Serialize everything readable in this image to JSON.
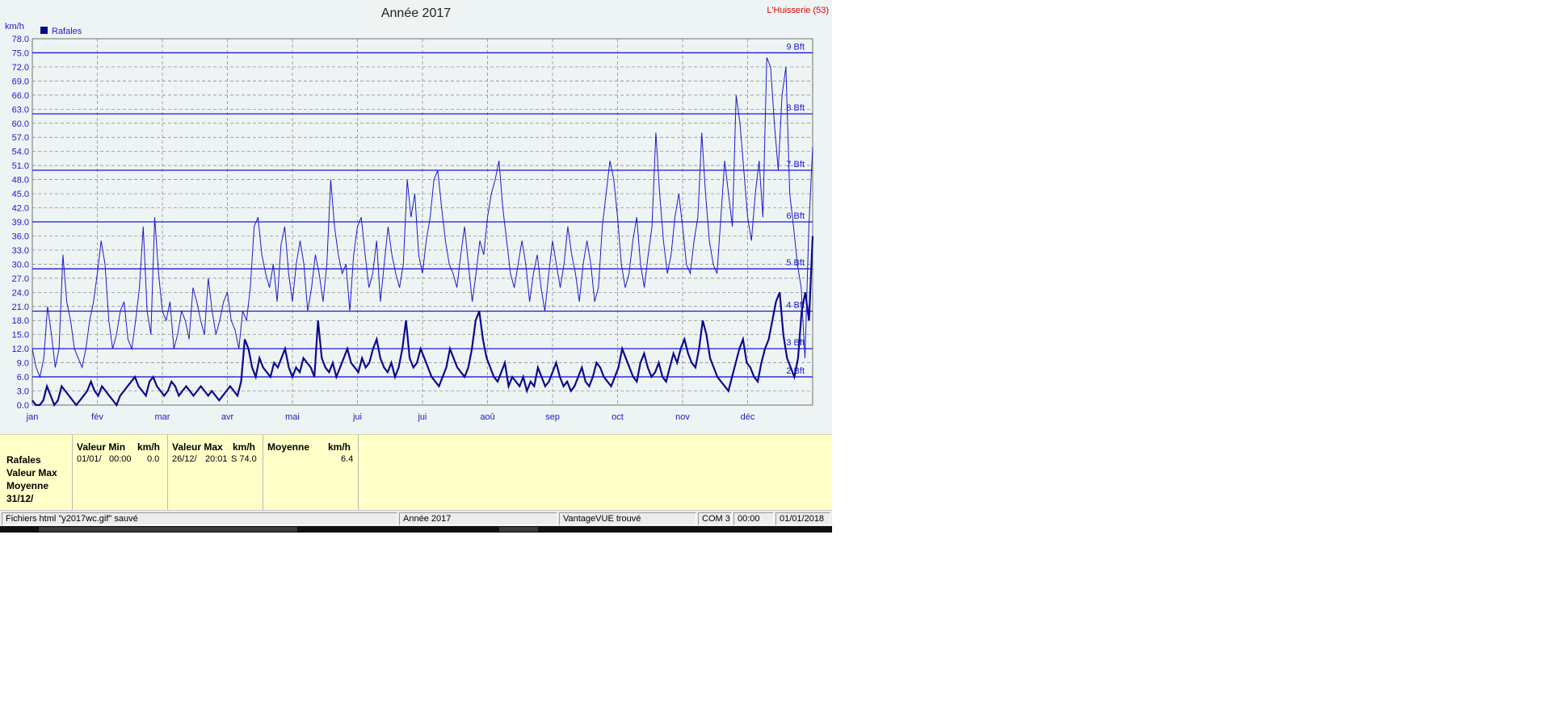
{
  "window": {
    "title": "Année 2017",
    "station": "L'Huisserie (53)"
  },
  "chart_data": {
    "type": "line",
    "title": "Année 2017",
    "ylabel": "km/h",
    "xlabel": "",
    "ylim": [
      0,
      78
    ],
    "yticks": [
      "0.0",
      "3.0",
      "6.0",
      "9.0",
      "12.0",
      "15.0",
      "18.0",
      "21.0",
      "24.0",
      "27.0",
      "30.0",
      "33.0",
      "36.0",
      "39.0",
      "42.0",
      "45.0",
      "48.0",
      "51.0",
      "54.0",
      "57.0",
      "60.0",
      "63.0",
      "66.0",
      "69.0",
      "72.0",
      "75.0",
      "78.0"
    ],
    "categories": [
      "jan",
      "fév",
      "mar",
      "avr",
      "mai",
      "juin",
      "juil",
      "aoû",
      "sep",
      "oct",
      "nov",
      "déc"
    ],
    "xticks": [
      "jan",
      "fév",
      "mar",
      "avr",
      "mai",
      "jui",
      "jui",
      "aoû",
      "sep",
      "oct",
      "nov",
      "déc"
    ],
    "legend": [
      "Rafales"
    ],
    "legend_position": "top-left",
    "grid": true,
    "beaufort": [
      {
        "label": "2 Bft",
        "value": 6
      },
      {
        "label": "3 Bft",
        "value": 12
      },
      {
        "label": "4 Bft",
        "value": 20
      },
      {
        "label": "5 Bft",
        "value": 29
      },
      {
        "label": "6 Bft",
        "value": 39
      },
      {
        "label": "7 Bft",
        "value": 50
      },
      {
        "label": "8 Bft",
        "value": 62
      },
      {
        "label": "9 Bft",
        "value": 75
      }
    ],
    "series": [
      {
        "name": "Rafales",
        "kind": "gusts",
        "color": "#1a1ad0",
        "values": [
          12,
          8,
          6,
          10,
          21,
          15,
          8,
          12,
          32,
          22,
          18,
          12,
          10,
          8,
          12,
          18,
          22,
          28,
          35,
          30,
          18,
          12,
          15,
          20,
          22,
          14,
          12,
          18,
          25,
          38,
          20,
          15,
          40,
          28,
          20,
          18,
          22,
          12,
          15,
          20,
          18,
          14,
          25,
          22,
          18,
          15,
          27,
          20,
          15,
          18,
          22,
          24,
          18,
          16,
          12,
          20,
          18,
          25,
          38,
          40,
          32,
          28,
          25,
          30,
          22,
          34,
          38,
          28,
          22,
          30,
          35,
          30,
          20,
          25,
          32,
          28,
          22,
          30,
          48,
          38,
          32,
          28,
          30,
          20,
          32,
          38,
          40,
          32,
          25,
          28,
          35,
          22,
          30,
          38,
          32,
          28,
          25,
          30,
          48,
          40,
          45,
          32,
          28,
          35,
          40,
          48,
          50,
          42,
          35,
          30,
          28,
          25,
          32,
          38,
          30,
          22,
          28,
          35,
          32,
          40,
          45,
          48,
          52,
          42,
          35,
          28,
          25,
          30,
          35,
          30,
          22,
          28,
          32,
          25,
          20,
          28,
          35,
          30,
          25,
          30,
          38,
          32,
          28,
          22,
          30,
          35,
          30,
          22,
          25,
          38,
          45,
          52,
          48,
          40,
          30,
          25,
          28,
          35,
          40,
          30,
          25,
          32,
          38,
          58,
          45,
          35,
          28,
          32,
          40,
          45,
          38,
          30,
          28,
          35,
          40,
          58,
          45,
          35,
          30,
          28,
          40,
          52,
          45,
          38,
          66,
          60,
          50,
          40,
          35,
          45,
          52,
          40,
          74,
          72,
          60,
          50,
          66,
          72,
          45,
          38,
          30,
          25,
          10,
          38,
          55
        ]
      },
      {
        "name": "Moyenne",
        "kind": "average",
        "color": "#0a0a90",
        "values": [
          1,
          0,
          0,
          1,
          4,
          2,
          0,
          1,
          4,
          3,
          2,
          1,
          0,
          1,
          2,
          3,
          5,
          3,
          2,
          4,
          3,
          2,
          1,
          0,
          2,
          3,
          4,
          5,
          6,
          4,
          3,
          2,
          5,
          6,
          4,
          3,
          2,
          3,
          5,
          4,
          2,
          3,
          4,
          3,
          2,
          3,
          4,
          3,
          2,
          3,
          2,
          1,
          2,
          3,
          4,
          3,
          2,
          5,
          14,
          12,
          8,
          6,
          10,
          8,
          7,
          6,
          9,
          8,
          10,
          12,
          8,
          6,
          8,
          7,
          10,
          9,
          8,
          6,
          18,
          10,
          8,
          7,
          9,
          6,
          8,
          10,
          12,
          9,
          8,
          7,
          10,
          8,
          9,
          12,
          14,
          10,
          8,
          7,
          9,
          6,
          8,
          12,
          18,
          10,
          8,
          9,
          12,
          10,
          8,
          6,
          5,
          4,
          6,
          8,
          12,
          10,
          8,
          7,
          6,
          8,
          12,
          18,
          20,
          14,
          10,
          8,
          6,
          5,
          7,
          9,
          4,
          6,
          5,
          4,
          6,
          3,
          5,
          4,
          8,
          6,
          4,
          5,
          7,
          9,
          6,
          4,
          5,
          3,
          4,
          6,
          8,
          5,
          4,
          6,
          9,
          8,
          6,
          5,
          4,
          6,
          8,
          12,
          10,
          8,
          6,
          5,
          9,
          11,
          8,
          6,
          7,
          9,
          6,
          5,
          8,
          11,
          9,
          12,
          14,
          11,
          9,
          8,
          12,
          18,
          15,
          10,
          8,
          6,
          5,
          4,
          3,
          6,
          9,
          12,
          14,
          9,
          8,
          6,
          5,
          9,
          12,
          14,
          18,
          22,
          24,
          15,
          10,
          8,
          6,
          10,
          20,
          24,
          18,
          36
        ]
      }
    ]
  },
  "stats": {
    "row_labels": [
      "Rafales",
      "Valeur Max",
      "Moyenne",
      "31/12/"
    ],
    "min": {
      "header": "Valeur Min",
      "unit": "km/h",
      "date": "01/01/",
      "time": "00:00",
      "value": "0.0"
    },
    "max": {
      "header": "Valeur Max",
      "unit": "km/h",
      "date": "26/12/",
      "time": "20:01",
      "value": "S 74.0"
    },
    "avg": {
      "header": "Moyenne",
      "unit": "km/h",
      "value": "6.4"
    }
  },
  "status_bar": {
    "message": "Fichiers html  \"y2017wc.gif\"  sauvé",
    "period": "Année 2017",
    "device": "VantageVUE trouvé",
    "port": "COM 3",
    "time": "00:00",
    "date": "01/01/2018"
  },
  "taskbar": {
    "clock": "00:00"
  }
}
